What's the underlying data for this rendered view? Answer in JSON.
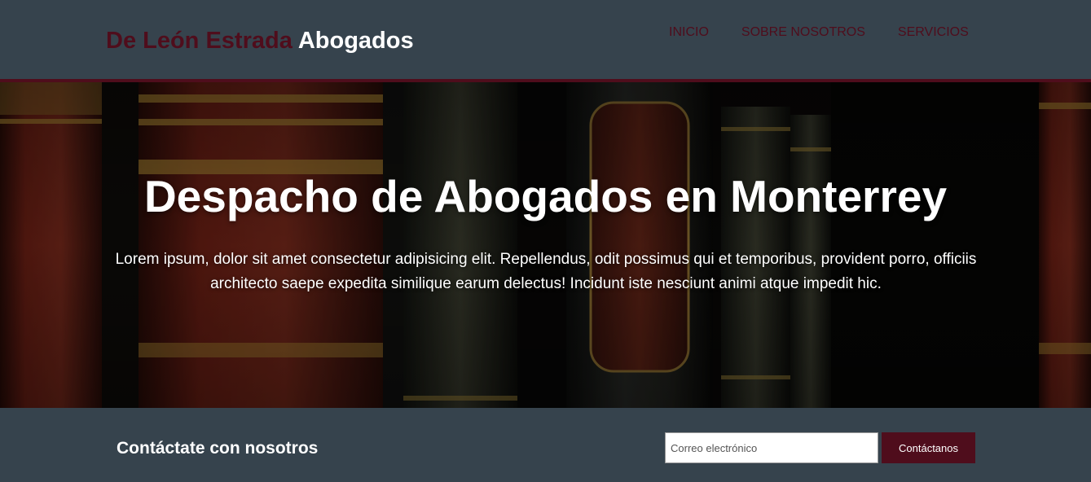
{
  "header": {
    "logo_part_a": "De León Estrada",
    "logo_part_b": "Abogados",
    "nav": [
      {
        "label": "INICIO"
      },
      {
        "label": "SOBRE NOSOTROS"
      },
      {
        "label": "SERVICIOS"
      }
    ]
  },
  "hero": {
    "title": "Despacho de Abogados en Monterrey",
    "text": "Lorem ipsum, dolor sit amet consectetur adipisicing elit. Repellendus, odit possimus qui et temporibus, provident porro, officiis architecto saepe expedita similique earum delectus! Incidunt iste nesciunt animi atque impedit hic.",
    "background_image": "bookshelf-law-books-photo"
  },
  "contact": {
    "heading": "Contáctate con nosotros",
    "email_placeholder": "Correo electrónico",
    "email_value": "",
    "button_label": "Contáctanos"
  },
  "colors": {
    "header_bg": "#36434d",
    "accent_burgundy": "#4f0d1c",
    "white": "#ffffff"
  }
}
